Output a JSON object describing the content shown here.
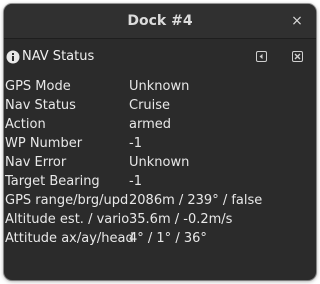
{
  "window": {
    "title": "Dock #4",
    "close_glyph": "×"
  },
  "panel": {
    "title": "NAV Status",
    "icons": {
      "info": "info-icon",
      "undock": "undock-icon",
      "close": "close-panel-icon"
    }
  },
  "rows": [
    {
      "label": "GPS Mode",
      "value": "Unknown"
    },
    {
      "label": "Nav Status",
      "value": "Cruise"
    },
    {
      "label": "Action",
      "value": "armed"
    },
    {
      "label": "WP Number",
      "value": "-1"
    },
    {
      "label": "Nav Error",
      "value": "Unknown"
    },
    {
      "label": "Target Bearing",
      "value": "-1"
    },
    {
      "label": "GPS range/brg/upd",
      "value": "2086m / 239° / false"
    },
    {
      "label": "Altitude est. / vario",
      "value": "35.6m / -0.2m/s"
    },
    {
      "label": "Attitude ax/ay/head",
      "value": "4° / 1° / 36°"
    }
  ],
  "colors": {
    "window_bg": "#2b2b2b",
    "titlebar_bg": "#303030",
    "text": "#e8e8e8",
    "title_text": "#dcdcdc"
  }
}
